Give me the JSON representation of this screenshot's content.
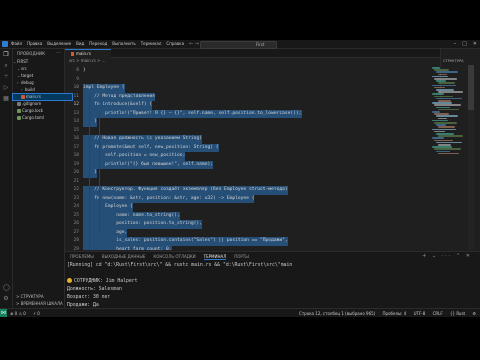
{
  "menu": [
    "Файл",
    "Правка",
    "Выделение",
    "Вид",
    "Переход",
    "Выполнить",
    "Терминал",
    "Справка"
  ],
  "search": {
    "label": "First"
  },
  "sidebar": {
    "header": "ПРОВОДНИК",
    "root": "FIRST",
    "items": [
      {
        "label": "src",
        "indent": 1,
        "kind": "folder"
      },
      {
        "label": "target",
        "indent": 1,
        "kind": "folder"
      },
      {
        "label": "debug",
        "indent": 1,
        "kind": "folder"
      },
      {
        "label": "build",
        "indent": 2,
        "kind": "folder"
      },
      {
        "label": "main.rs",
        "indent": 2,
        "kind": "file",
        "selected": true
      },
      {
        "label": ".gitignore",
        "indent": 1,
        "kind": "file"
      },
      {
        "label": "Cargo.lock",
        "indent": 1,
        "kind": "file"
      },
      {
        "label": "Cargo.toml",
        "indent": 1,
        "kind": "file"
      }
    ],
    "bottom": [
      "> СТРУКТУРА",
      "> ВРЕМЕННАЯ ШКАЛА"
    ]
  },
  "tabs": [
    {
      "label": "main.rs",
      "active": true
    }
  ],
  "breadcrumb": "src > main.rs > ...",
  "outline_header": "СТРУКТУРА",
  "editor": {
    "lines": [
      {
        "n": "8",
        "code": "}"
      },
      {
        "n": "9",
        "code": ""
      },
      {
        "n": "10",
        "code": "impl Employee {"
      },
      {
        "n": "11",
        "code": "    // Метод представления"
      },
      {
        "n": "12",
        "code": "    fn introduce(&self) {"
      },
      {
        "n": "13",
        "code": "        println!(\"Привет! Я {} — {}\", self.name, self.position.to_lowercase());"
      },
      {
        "n": "14",
        "code": "    }"
      },
      {
        "n": "15",
        "code": ""
      },
      {
        "n": "16",
        "code": "    // Новая должность (с указанием String)"
      },
      {
        "n": "17",
        "code": "    fn promote(&mut self, new_position: String) {"
      },
      {
        "n": "18",
        "code": "        self.position = new_position;"
      },
      {
        "n": "19",
        "code": "        println!(\"{} был повышен!\", self.name);"
      },
      {
        "n": "20",
        "code": "    }"
      },
      {
        "n": "21",
        "code": ""
      },
      {
        "n": "22",
        "code": "    // Конструктор. Функция создаёт экземпляр (без Employee struct-метода)"
      },
      {
        "n": "23",
        "code": "    fn new(name: &str, position: &str, age: u32) -> Employee {"
      },
      {
        "n": "24",
        "code": "        Employee {"
      },
      {
        "n": "25",
        "code": "            name: name.to_string(),"
      },
      {
        "n": "26",
        "code": "            position: position.to_string(),"
      },
      {
        "n": "27",
        "code": "            age,"
      },
      {
        "n": "28",
        "code": "            is_sales: position.contains(\"Sales\") || position == \"Продажи\","
      },
      {
        "n": "29",
        "code": "            heart_farm_count: 0,"
      },
      {
        "n": "30",
        "code": "        }"
      },
      {
        "n": "31",
        "code": "    }"
      },
      {
        "n": "32",
        "code": "}"
      }
    ]
  },
  "panel": {
    "tabs": [
      "ПРОБЛЕМЫ",
      "ВЫХОДНЫЕ ДАННЫЕ",
      "КОНСОЛЬ ОТЛАДКИ",
      "ТЕРМИНАЛ",
      "ПОРТЫ"
    ],
    "active_tab": "ТЕРМИНАЛ",
    "lines": [
      "[Running] cd \"d:\\Rust\\First\\src\\\" && rustc main.rs && \"d:\\Rust\\First\\src\\\"main",
      "",
      "СОТРУДНИК: Jim Halpert",
      "Должность: Salesman",
      "Возраст: 30 лет",
      "Продажи: Да"
    ]
  },
  "status": {
    "left": [
      "⊗ 0 ⚠ 0",
      "⚡ 0"
    ],
    "right": [
      "Строка 12, столбец 1 (выбрано 965)",
      "Пробелы: 4",
      "UTF-8",
      "CRLF",
      "{} Rust",
      "⚙"
    ]
  }
}
